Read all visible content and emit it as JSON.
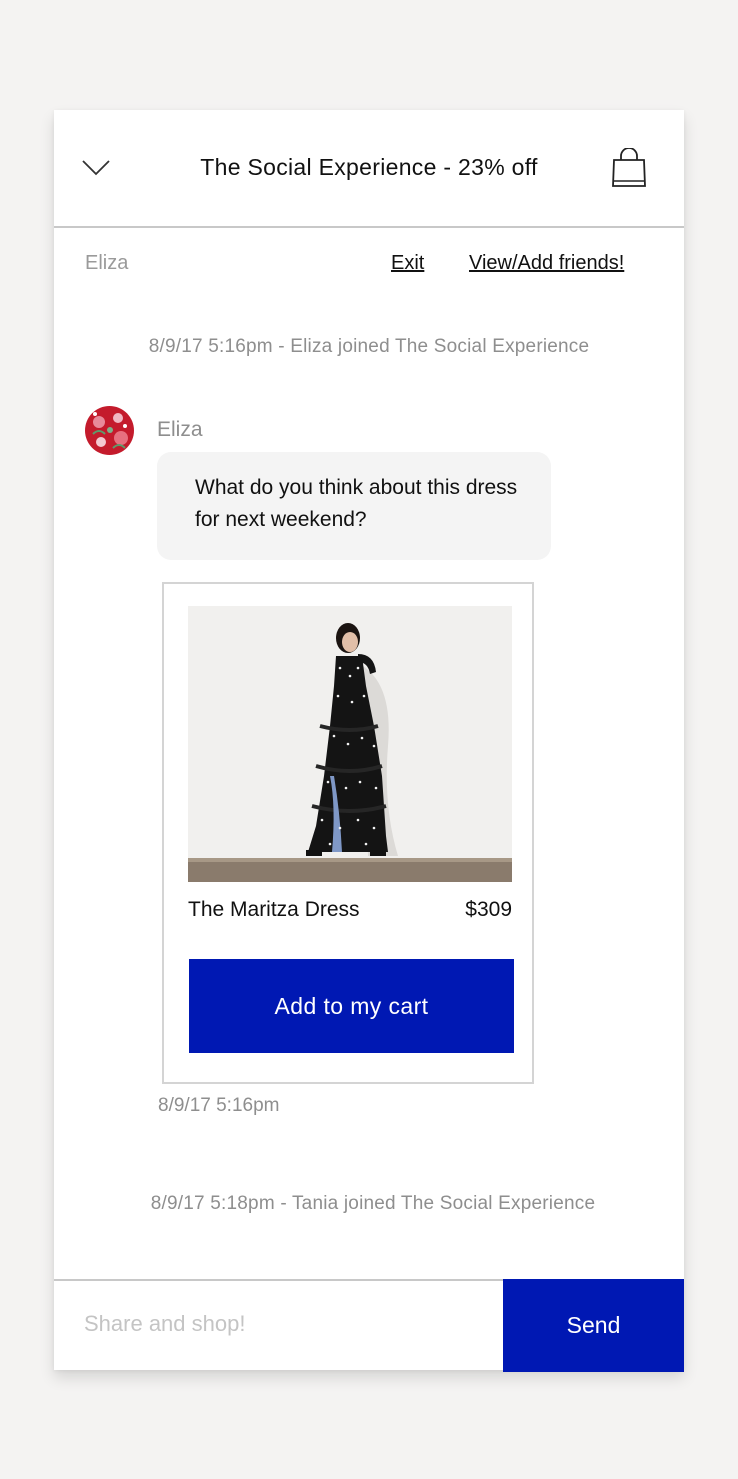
{
  "header": {
    "title": "The Social Experience - 23% off",
    "collapse_icon": "chevron-down-icon",
    "bag_icon": "shopping-bag-icon"
  },
  "subbar": {
    "user": "Eliza",
    "exit_label": "Exit",
    "friends_label": "View/Add friends!"
  },
  "messages": {
    "system_1": "8/9/17 5:16pm - Eliza joined The Social Experience",
    "sender": "Eliza",
    "text_line_1": "What do you think about this dress",
    "text_line_2": "for next weekend?",
    "time": "8/9/17 5:16pm",
    "system_2": "8/9/17 5:18pm - Tania joined The Social Experience"
  },
  "product": {
    "name": "The Maritza Dress",
    "price": "$309",
    "cart_label": "Add to my cart"
  },
  "composer": {
    "placeholder": "Share and shop!",
    "send_label": "Send"
  },
  "colors": {
    "accent": "#0018b3",
    "muted_text": "#8e8e8e",
    "bubble_bg": "#f4f4f4"
  }
}
